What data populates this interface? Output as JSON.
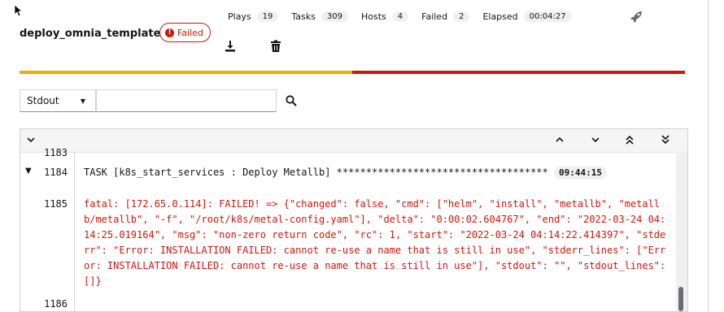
{
  "job": {
    "name": "deploy_omnia_template",
    "status": "Failed"
  },
  "stats": [
    {
      "label": "Plays",
      "count": "19"
    },
    {
      "label": "Tasks",
      "count": "309"
    },
    {
      "label": "Hosts",
      "count": "4"
    },
    {
      "label": "Failed",
      "count": "2"
    },
    {
      "label": "Elapsed",
      "count": "00:04:27"
    }
  ],
  "icons": {
    "rocket": "rocket-icon",
    "download": "download-icon",
    "delete": "trash-icon",
    "search": "search-icon"
  },
  "progress": {
    "ok_fraction": 0.5,
    "ok_color": "#f0ab00",
    "failed_color": "#c9190b"
  },
  "filter": {
    "stream_selected": "Stdout",
    "search_value": ""
  },
  "log": {
    "lines": [
      {
        "number": "1183",
        "text": ""
      },
      {
        "number": "1184",
        "text": "TASK [k8s_start_services : Deploy Metallb] ************************************",
        "time": "09:44:15"
      },
      {
        "number": "1185",
        "text": "fatal: [172.65.0.114]: FAILED! => {\"changed\": false, \"cmd\": [\"helm\", \"install\", \"metallb\", \"metallb/metallb\", \"-f\", \"/root/k8s/metal-config.yaml\"], \"delta\": \"0:00:02.604767\", \"end\": \"2022-03-24 04:14:25.019164\", \"msg\": \"non-zero return code\", \"rc\": 1, \"start\": \"2022-03-24 04:14:22.414397\", \"stderr\": \"Error: INSTALLATION FAILED: cannot re-use a name that is still in use\", \"stderr_lines\": [\"Error: INSTALLATION FAILED: cannot re-use a name that is still in use\"], \"stdout\": \"\", \"stdout_lines\": []}"
      },
      {
        "number": "1186",
        "text": ""
      }
    ]
  }
}
